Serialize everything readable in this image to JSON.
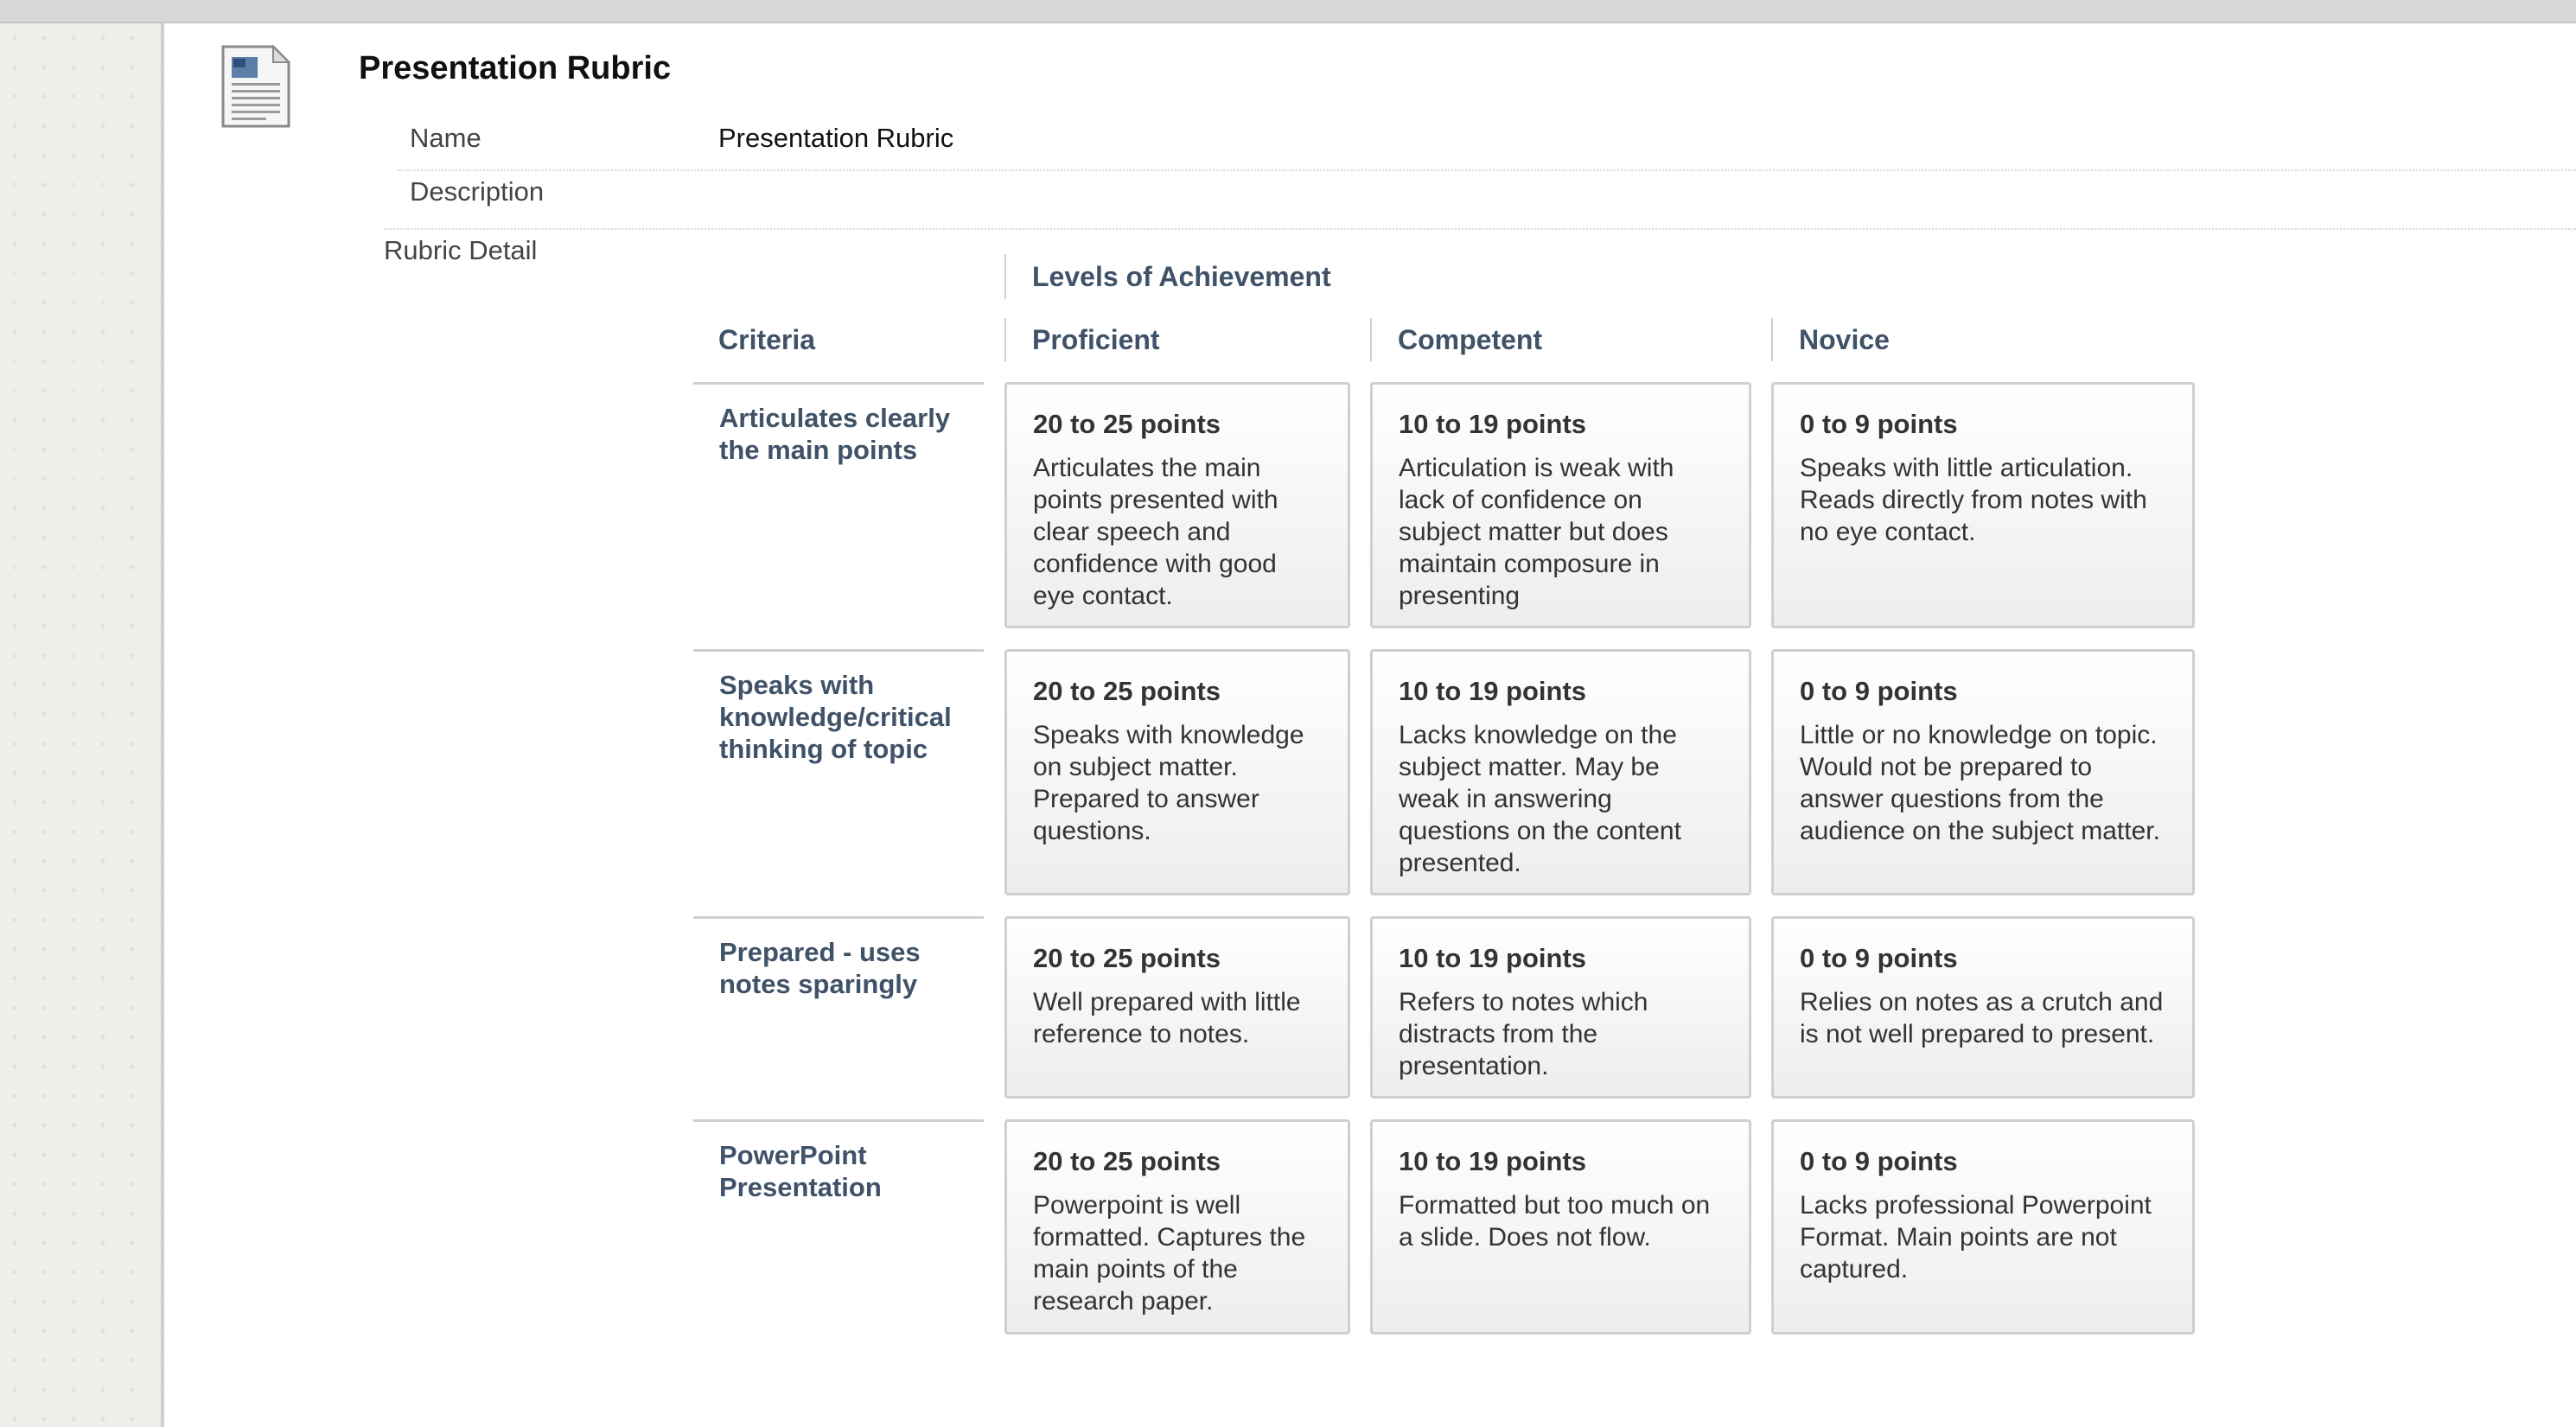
{
  "page": {
    "title": "Presentation Rubric"
  },
  "meta": {
    "name_label": "Name",
    "name_value": "Presentation Rubric",
    "description_label": "Description",
    "description_value": ""
  },
  "rubric": {
    "detail_label": "Rubric Detail",
    "levels_header": "Levels of Achievement",
    "criteria_header": "Criteria",
    "levels": [
      "Proficient",
      "Competent",
      "Novice"
    ],
    "rows": [
      {
        "criterion": "Articulates clearly the main points",
        "cells": [
          {
            "points": "20 to 25 points",
            "desc": "Articulates the main points presented with clear speech and confidence with good eye contact."
          },
          {
            "points": "10 to 19 points",
            "desc": "Articulation is weak with lack of confidence on subject matter but does maintain composure in presenting"
          },
          {
            "points": "0 to 9 points",
            "desc": "Speaks with little articulation. Reads directly from notes with no eye contact."
          }
        ]
      },
      {
        "criterion": "Speaks with knowledge/critical thinking of topic",
        "cells": [
          {
            "points": "20 to 25 points",
            "desc": "Speaks with knowledge on subject matter. Prepared to answer questions."
          },
          {
            "points": "10 to 19 points",
            "desc": "Lacks knowledge on the subject matter. May be weak in answering questions on the content presented."
          },
          {
            "points": "0 to 9 points",
            "desc": "Little or no knowledge on topic. Would not be prepared to answer questions from the audience on the subject matter."
          }
        ]
      },
      {
        "criterion": "Prepared - uses notes sparingly",
        "cells": [
          {
            "points": "20 to 25 points",
            "desc": "Well prepared with little reference to notes."
          },
          {
            "points": "10 to 19 points",
            "desc": "Refers to notes which distracts from the presentation."
          },
          {
            "points": "0 to 9 points",
            "desc": "Relies on notes as a crutch and is not well prepared to present."
          }
        ]
      },
      {
        "criterion": "PowerPoint Presentation",
        "cells": [
          {
            "points": "20 to 25 points",
            "desc": "Powerpoint is well formatted. Captures the main points of the research paper."
          },
          {
            "points": "10 to 19 points",
            "desc": "Formatted but too much on a slide. Does not flow."
          },
          {
            "points": "0 to 9 points",
            "desc": "Lacks professional Powerpoint Format. Main points are not captured."
          }
        ]
      }
    ]
  }
}
